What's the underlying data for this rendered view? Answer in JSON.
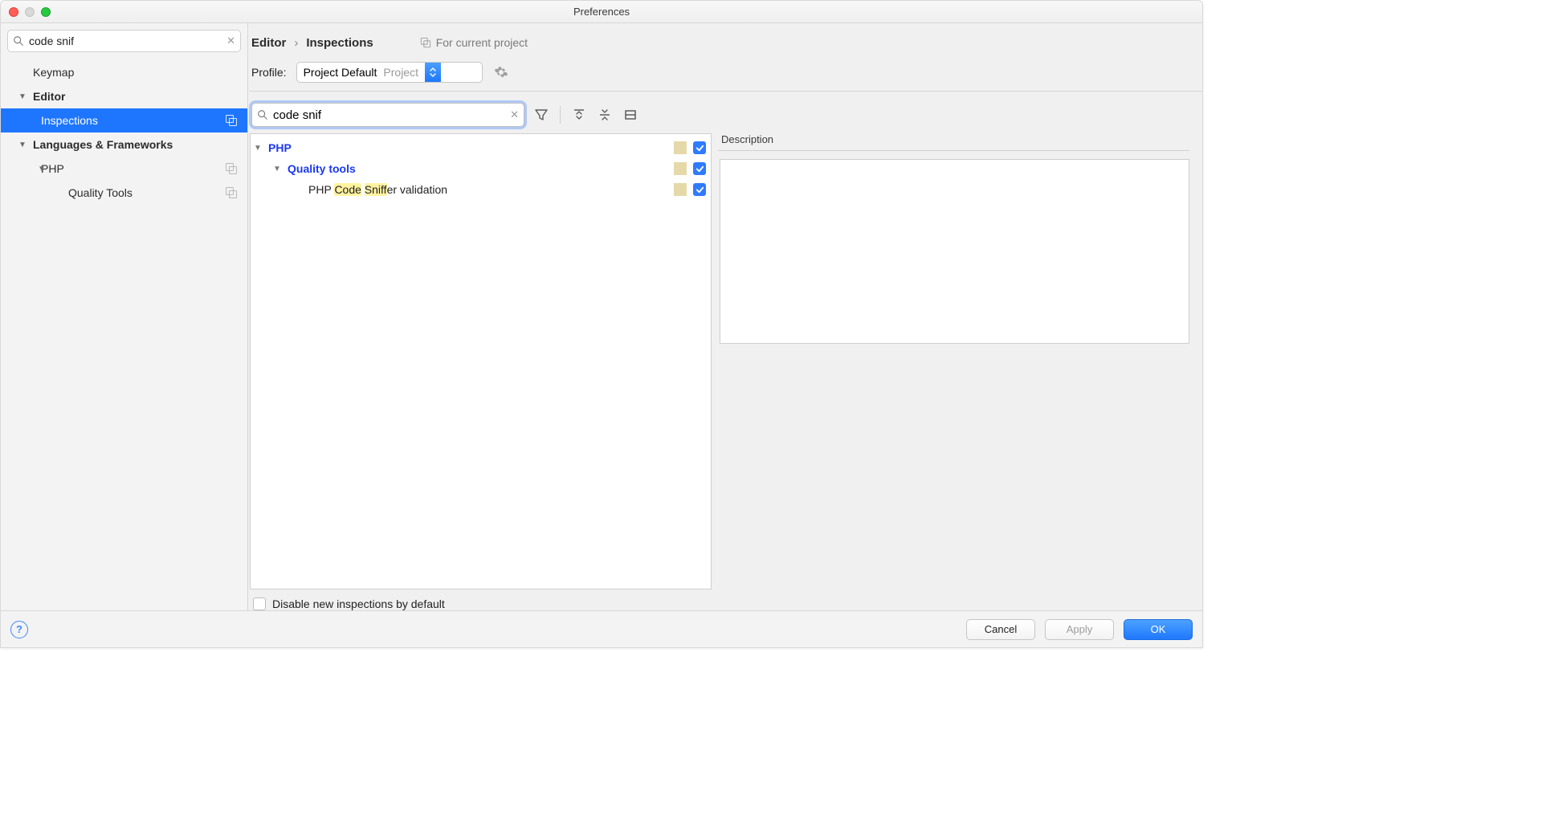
{
  "window": {
    "title": "Preferences"
  },
  "sidebar": {
    "search_value": "code snif",
    "items": {
      "keymap": "Keymap",
      "editor": "Editor",
      "inspections": "Inspections",
      "lang_fw": "Languages & Frameworks",
      "php": "PHP",
      "quality_tools": "Quality Tools"
    }
  },
  "breadcrumb": {
    "editor": "Editor",
    "inspections": "Inspections"
  },
  "scope": {
    "label": "For current project"
  },
  "profile": {
    "label": "Profile:",
    "selected": "Project Default",
    "scope": "Project"
  },
  "inspections": {
    "search_value": "code snif",
    "rows": {
      "php": "PHP",
      "quality_tools": "Quality tools",
      "php_code_sniffer_prefix": "PHP ",
      "php_code_sniffer_hl1": "Code",
      "php_code_sniffer_mid": " ",
      "php_code_sniffer_hl2": "Sniff",
      "php_code_sniffer_suffix": "er validation"
    },
    "disable_new_label": "Disable new inspections by default"
  },
  "description": {
    "title": "Description"
  },
  "footer": {
    "cancel": "Cancel",
    "apply": "Apply",
    "ok": "OK"
  }
}
